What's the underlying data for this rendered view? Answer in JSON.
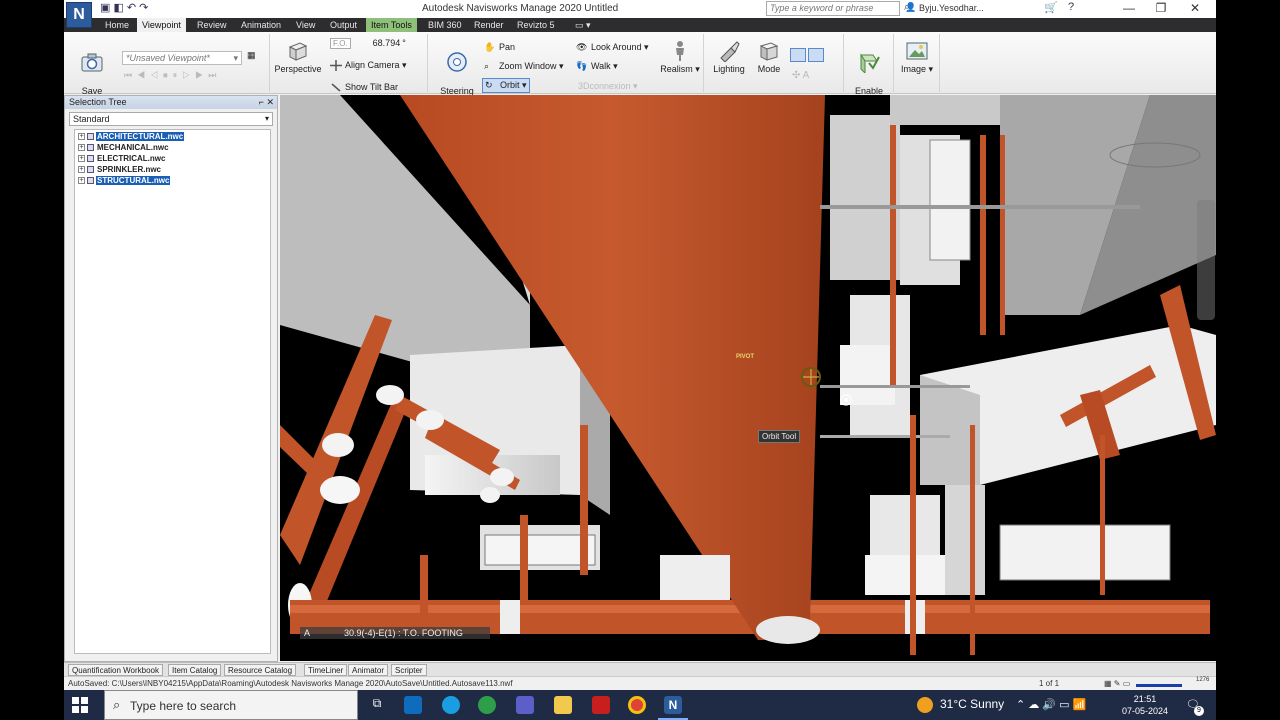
{
  "window": {
    "title": "Autodesk Navisworks Manage 2020    Untitled",
    "logo_letter": "N",
    "search_placeholder": "Type a keyword or phrase",
    "user": "Byju.Yesodhar..."
  },
  "tabs": [
    "Home",
    "Viewpoint",
    "Review",
    "Animation",
    "View",
    "Output",
    "Item Tools",
    "BIM 360",
    "Render",
    "Revizto 5"
  ],
  "active_tab": "Viewpoint",
  "context_tab": "Item Tools",
  "ribbon": {
    "save_viewpoint": "Save\nViewpoint",
    "viewpoint_combo": "*Unsaved Viewpoint*",
    "perspective": "Perspective",
    "fov_label": "F.O.",
    "fov_value": "68.794",
    "align_camera": "Align Camera",
    "show_tilt_bar": "Show Tilt Bar",
    "steering_wheels": "Steering\nWheels",
    "pan": "Pan",
    "zoom_window": "Zoom Window",
    "orbit": "Orbit",
    "look_around": "Look Around",
    "walk": "Walk",
    "connexion": "3Dconnexion",
    "realism": "Realism",
    "lighting": "Lighting",
    "mode": "Mode",
    "enable_sectioning": "Enable\nSectioning",
    "image": "Image"
  },
  "selection_tree": {
    "title": "Selection Tree",
    "mode": "Standard",
    "items": [
      {
        "label": "ARCHITECTURAL.nwc",
        "selected": true
      },
      {
        "label": "MECHANICAL.nwc",
        "selected": false
      },
      {
        "label": "ELECTRICAL.nwc",
        "selected": false
      },
      {
        "label": "SPRINKLER.nwc",
        "selected": false
      },
      {
        "label": "STRUCTURAL.nwc",
        "selected": true
      }
    ]
  },
  "viewport": {
    "tooltip": "Orbit Tool",
    "pivot_label": "PIVOT",
    "grid_axis": "A",
    "grid_location": "30.9(-4)-E(1) : T.O. FOOTING"
  },
  "bottom_tabs": [
    "Quantification Workbook",
    "Item Catalog",
    "Resource Catalog",
    "TimeLiner",
    "Animator",
    "Scripter"
  ],
  "status": {
    "autosave": "AutoSaved: C:\\Users\\INBY04215\\AppData\\Roaming\\Autodesk Navisworks Manage 2020\\AutoSave\\Untitled.Autosave113.nwf",
    "pages": "1 of 1",
    "memory": "1276"
  },
  "taskbar": {
    "search_placeholder": "Type here to search",
    "weather": "31°C  Sunny",
    "time": "21:51",
    "date": "07-05-2024",
    "notifications": "9"
  },
  "colors": {
    "pipe": "#c2542a",
    "duct": "#e6e6e6",
    "accent": "#1a5fb4"
  }
}
